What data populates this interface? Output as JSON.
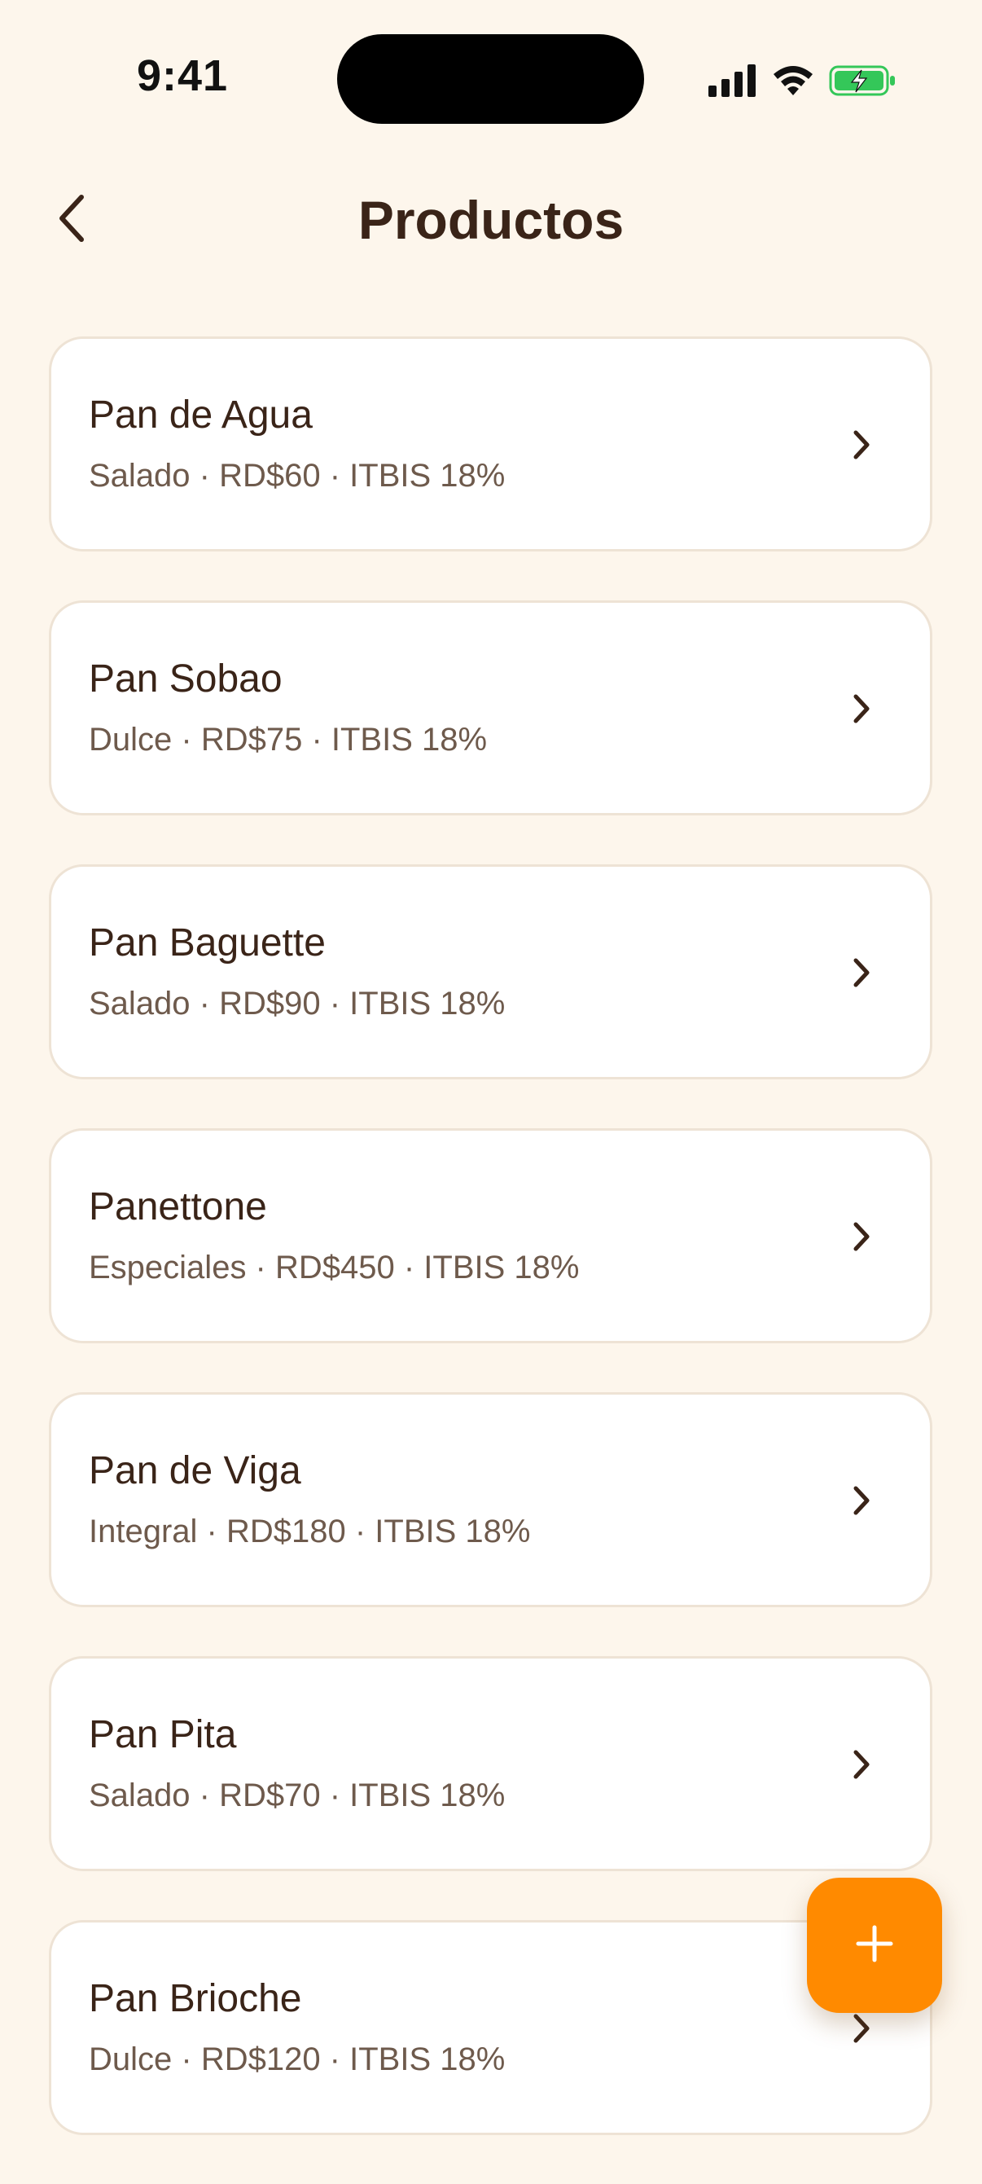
{
  "status_bar": {
    "time": "9:41"
  },
  "header": {
    "title": "Productos"
  },
  "colors": {
    "background": "#FDF6EC",
    "accent": "#FF8A00",
    "text_primary": "#3A2418",
    "text_secondary": "#6E5A4C",
    "battery_green": "#34C759"
  },
  "icons": {
    "back": "chevron-left-icon",
    "row": "chevron-right-icon",
    "fab": "plus-icon",
    "signal": "cellular-signal-icon",
    "wifi": "wifi-icon",
    "battery": "battery-charging-icon"
  },
  "products": [
    {
      "name": "Pan de Agua",
      "meta": "Salado · RD$60 · ITBIS 18%"
    },
    {
      "name": "Pan Sobao",
      "meta": "Dulce · RD$75 · ITBIS 18%"
    },
    {
      "name": "Pan Baguette",
      "meta": "Salado · RD$90 · ITBIS 18%"
    },
    {
      "name": "Panettone",
      "meta": "Especiales · RD$450 · ITBIS 18%"
    },
    {
      "name": "Pan de Viga",
      "meta": "Integral · RD$180 · ITBIS 18%"
    },
    {
      "name": "Pan Pita",
      "meta": "Salado · RD$70 · ITBIS 18%"
    },
    {
      "name": "Pan Brioche",
      "meta": "Dulce · RD$120 · ITBIS 18%"
    }
  ]
}
